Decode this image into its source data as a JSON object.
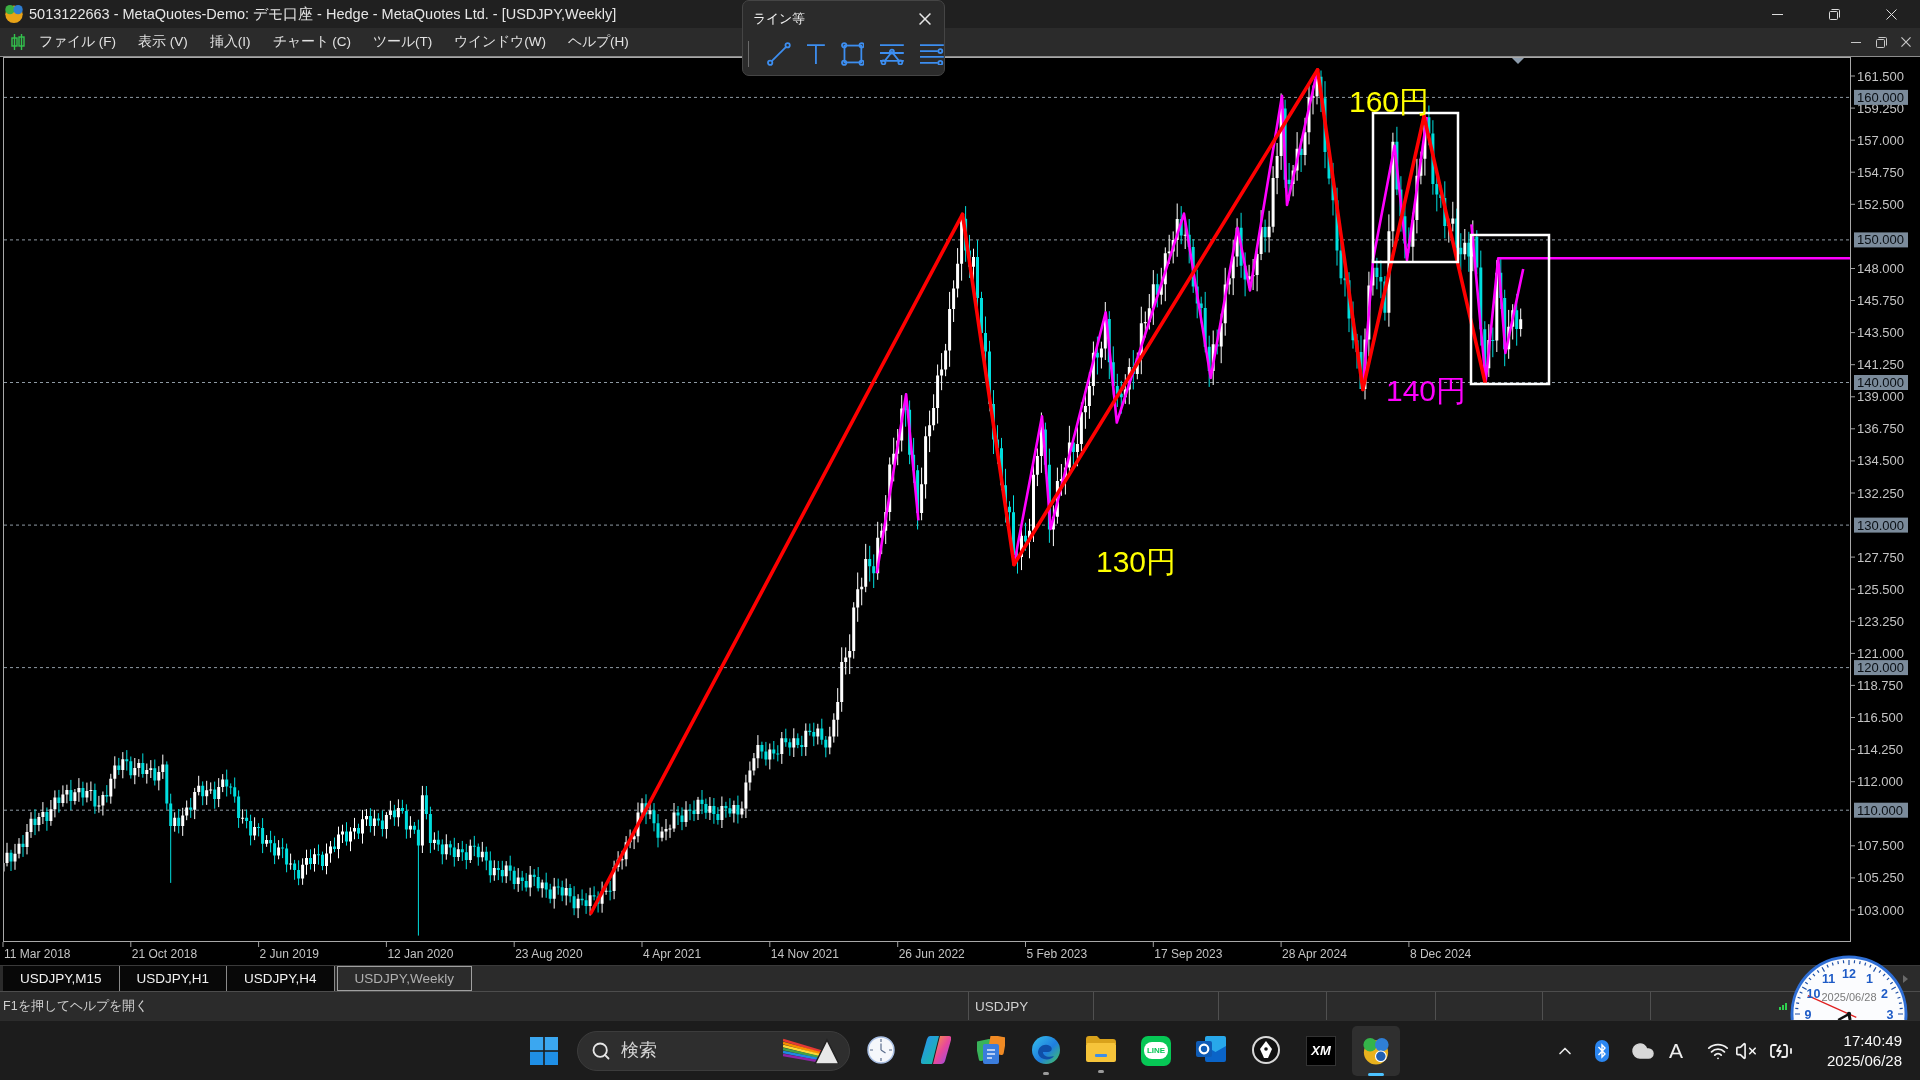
{
  "window": {
    "title": "5013122663 - MetaQuotes-Demo: デモ口座 - Hedge - MetaQuotes Ltd. - [USDJPY,Weekly]"
  },
  "menu": [
    "ファイル (F)",
    "表示 (V)",
    "挿入(I)",
    "チャート (C)",
    "ツール(T)",
    "ウインドウ(W)",
    "ヘルプ(H)"
  ],
  "line_toolbar": {
    "title": "ライン等"
  },
  "chart": {
    "price_labels": [
      "161.500",
      "159.250",
      "157.000",
      "154.750",
      "152.500",
      "148.000",
      "145.750",
      "143.500",
      "141.250",
      "139.000",
      "136.750",
      "134.500",
      "132.250",
      "127.750",
      "125.500",
      "123.250",
      "121.000",
      "118.750",
      "116.500",
      "114.250",
      "112.000",
      "107.500",
      "105.250",
      "103.000"
    ],
    "level_tags": [
      "160.000",
      "150.000",
      "140.000",
      "130.000",
      "120.000",
      "110.000"
    ],
    "date_labels": [
      "11 Mar 2018",
      "21 Oct 2018",
      "2 Jun 2019",
      "12 Jan 2020",
      "23 Aug 2020",
      "4 Apr 2021",
      "14 Nov 2021",
      "26 Jun 2022",
      "5 Feb 2023",
      "17 Sep 2023",
      "28 Apr 2024",
      "8 Dec 2024"
    ],
    "annotations": [
      {
        "text": "160円",
        "color": "#ffff00"
      },
      {
        "text": "140円",
        "color": "#ff00ff"
      },
      {
        "text": "130円",
        "color": "#ffff00"
      }
    ]
  },
  "tabs": [
    {
      "label": "USDJPY,M15",
      "selected": false
    },
    {
      "label": "USDJPY,H1",
      "selected": false
    },
    {
      "label": "USDJPY,H4",
      "selected": false
    },
    {
      "label": "USDJPY,Weekly",
      "selected": true
    }
  ],
  "status_bar": {
    "hint": "F1を押してヘルプを開く",
    "cells": [
      "USDJPY"
    ]
  },
  "clock_widget": {
    "numerals": [
      "12",
      "1",
      "2",
      "3",
      "9",
      "10",
      "11"
    ],
    "date": "2025/06/28"
  },
  "taskbar": {
    "search": {
      "placeholder": "検索"
    },
    "apps": [
      {
        "kind": "clock",
        "running": false,
        "active": false
      },
      {
        "kind": "ribbon",
        "running": false,
        "active": false
      },
      {
        "kind": "documents",
        "running": false,
        "active": false
      },
      {
        "kind": "browser",
        "running": true,
        "active": false
      },
      {
        "kind": "folder",
        "running": true,
        "active": false
      },
      {
        "kind": "chat",
        "text": "LINE",
        "running": false,
        "active": false
      },
      {
        "kind": "mail",
        "running": false,
        "active": false
      },
      {
        "kind": "pen",
        "running": false,
        "active": false
      },
      {
        "kind": "trading",
        "text": "XM",
        "running": false,
        "active": false
      },
      {
        "kind": "terminal",
        "running": true,
        "active": true
      }
    ],
    "tray": {
      "ime": "A",
      "time": "17:40:49",
      "date": "2025/06/28"
    }
  }
}
